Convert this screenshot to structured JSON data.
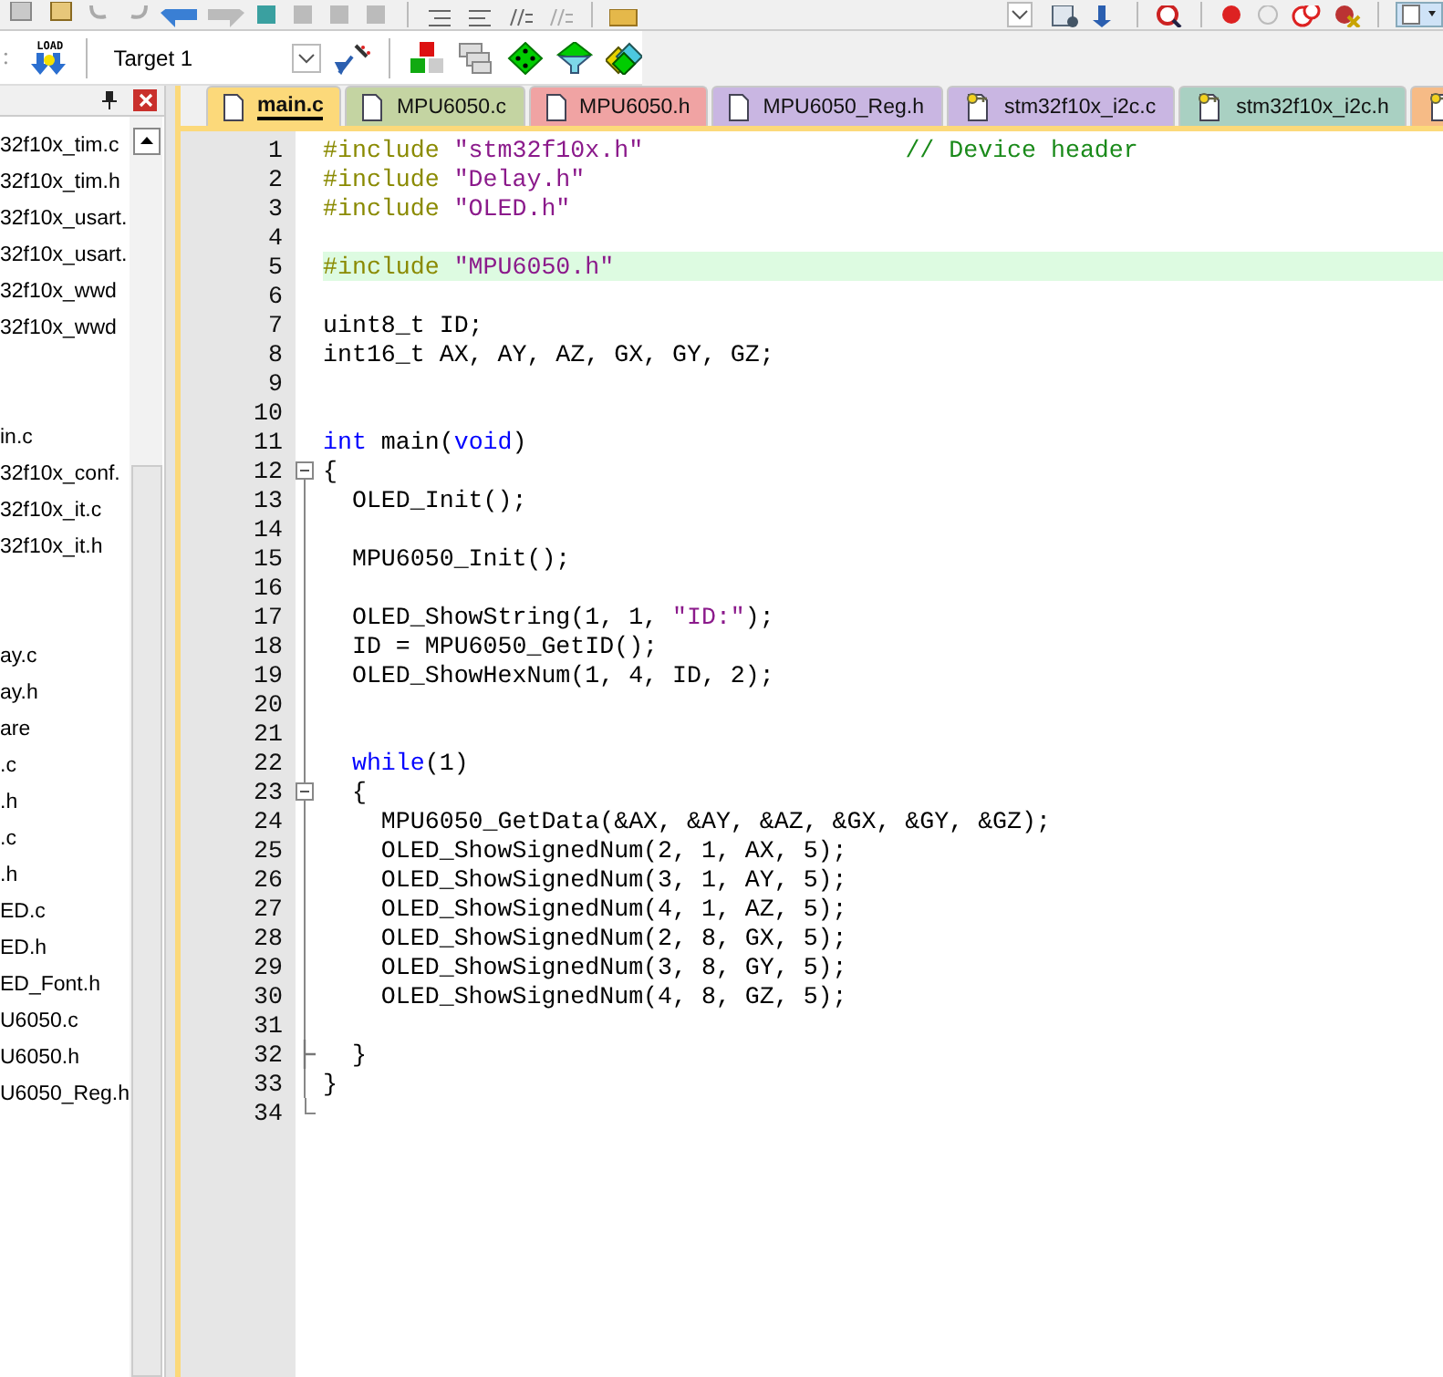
{
  "toolbar": {
    "load_label": "LOAD",
    "target": "Target 1"
  },
  "project_panel": {
    "groups": [
      {
        "items": [
          "32f10x_tim.c",
          "32f10x_tim.h",
          "32f10x_usart.",
          "32f10x_usart.",
          "32f10x_wwd",
          "32f10x_wwd"
        ]
      },
      {
        "items": [
          "in.c",
          "32f10x_conf.",
          "32f10x_it.c",
          "32f10x_it.h"
        ]
      },
      {
        "items": [
          "ay.c",
          "ay.h",
          "are",
          ".c",
          ".h",
          ".c",
          ".h",
          "ED.c",
          "ED.h",
          "ED_Font.h",
          "U6050.c",
          "U6050.h",
          "U6050_Reg.h"
        ]
      }
    ]
  },
  "tabs": [
    {
      "label": "main.c",
      "selected": true,
      "locked": false,
      "color": "#fcd97a"
    },
    {
      "label": "MPU6050.c",
      "selected": false,
      "locked": false,
      "color": "#c4d4a2"
    },
    {
      "label": "MPU6050.h",
      "selected": false,
      "locked": false,
      "color": "#f0a3a3"
    },
    {
      "label": "MPU6050_Reg.h",
      "selected": false,
      "locked": false,
      "color": "#c9b6e2"
    },
    {
      "label": "stm32f10x_i2c.c",
      "selected": false,
      "locked": true,
      "color": "#c9b6e2"
    },
    {
      "label": "stm32f10x_i2c.h",
      "selected": false,
      "locked": true,
      "color": "#a9d0c2"
    },
    {
      "selected": false,
      "locked": true,
      "color": "#f6bb86"
    }
  ],
  "code": [
    {
      "number": "1",
      "highlighted": false,
      "tokens": [
        {
          "kind": "pp",
          "text": "#include "
        },
        {
          "kind": "str",
          "text": "\"stm32f10x.h\"                  "
        },
        {
          "kind": "comment",
          "text": "// Device header"
        }
      ]
    },
    {
      "number": "2",
      "highlighted": false,
      "tokens": [
        {
          "kind": "pp",
          "text": "#include "
        },
        {
          "kind": "str",
          "text": "\"Delay.h\""
        }
      ]
    },
    {
      "number": "3",
      "highlighted": false,
      "tokens": [
        {
          "kind": "pp",
          "text": "#include "
        },
        {
          "kind": "str",
          "text": "\"OLED.h\""
        }
      ]
    },
    {
      "number": "4",
      "highlighted": false
    },
    {
      "number": "5",
      "highlighted": true,
      "tokens": [
        {
          "kind": "pp",
          "text": "#include "
        },
        {
          "kind": "str",
          "text": "\"MPU6050.h\""
        }
      ]
    },
    {
      "number": "6",
      "highlighted": false
    },
    {
      "number": "7",
      "highlighted": false,
      "tokens": [
        {
          "kind": "plain",
          "text": "uint8_t ID;"
        }
      ]
    },
    {
      "number": "8",
      "highlighted": false,
      "tokens": [
        {
          "kind": "plain",
          "text": "int16_t AX, AY, AZ, GX, GY, GZ;"
        }
      ]
    },
    {
      "number": "9",
      "highlighted": false
    },
    {
      "number": "10",
      "highlighted": false
    },
    {
      "number": "11",
      "highlighted": false,
      "tokens": [
        {
          "kind": "kw",
          "text": "int"
        },
        {
          "kind": "plain",
          "text": " main("
        },
        {
          "kind": "kw",
          "text": "void"
        },
        {
          "kind": "plain",
          "text": ")"
        }
      ]
    },
    {
      "number": "12",
      "highlighted": false,
      "collapsible": true,
      "tokens": [
        {
          "kind": "plain",
          "text": "{"
        }
      ]
    },
    {
      "number": "13",
      "highlighted": false,
      "tokens": [
        {
          "kind": "plain",
          "text": "  OLED_Init();"
        }
      ]
    },
    {
      "number": "14",
      "highlighted": false
    },
    {
      "number": "15",
      "highlighted": false,
      "tokens": [
        {
          "kind": "plain",
          "text": "  MPU6050_Init();"
        }
      ]
    },
    {
      "number": "16",
      "highlighted": false
    },
    {
      "number": "17",
      "highlighted": false,
      "tokens": [
        {
          "kind": "plain",
          "text": "  OLED_ShowString(1, 1, "
        },
        {
          "kind": "str",
          "text": "\"ID:\""
        },
        {
          "kind": "plain",
          "text": ");"
        }
      ]
    },
    {
      "number": "18",
      "highlighted": false,
      "tokens": [
        {
          "kind": "plain",
          "text": "  ID = MPU6050_GetID();"
        }
      ]
    },
    {
      "number": "19",
      "highlighted": false,
      "tokens": [
        {
          "kind": "plain",
          "text": "  OLED_ShowHexNum(1, 4, ID, 2);"
        }
      ]
    },
    {
      "number": "20",
      "highlighted": false
    },
    {
      "number": "21",
      "highlighted": false
    },
    {
      "number": "22",
      "highlighted": false,
      "tokens": [
        {
          "kind": "kw",
          "text": "  while"
        },
        {
          "kind": "plain",
          "text": "(1)"
        }
      ]
    },
    {
      "number": "23",
      "highlighted": false,
      "collapsible": true,
      "tokens": [
        {
          "kind": "plain",
          "text": "  {"
        }
      ]
    },
    {
      "number": "24",
      "highlighted": false,
      "tokens": [
        {
          "kind": "plain",
          "text": "    MPU6050_GetData(&AX, &AY, &AZ, &GX, &GY, &GZ);"
        }
      ]
    },
    {
      "number": "25",
      "highlighted": false,
      "tokens": [
        {
          "kind": "plain",
          "text": "    OLED_ShowSignedNum(2, 1, AX, 5);"
        }
      ]
    },
    {
      "number": "26",
      "highlighted": false,
      "tokens": [
        {
          "kind": "plain",
          "text": "    OLED_ShowSignedNum(3, 1, AY, 5);"
        }
      ]
    },
    {
      "number": "27",
      "highlighted": false,
      "tokens": [
        {
          "kind": "plain",
          "text": "    OLED_ShowSignedNum(4, 1, AZ, 5);"
        }
      ]
    },
    {
      "number": "28",
      "highlighted": false,
      "tokens": [
        {
          "kind": "plain",
          "text": "    OLED_ShowSignedNum(2, 8, GX, 5);"
        }
      ]
    },
    {
      "number": "29",
      "highlighted": false,
      "tokens": [
        {
          "kind": "plain",
          "text": "    OLED_ShowSignedNum(3, 8, GY, 5);"
        }
      ]
    },
    {
      "number": "30",
      "highlighted": false,
      "tokens": [
        {
          "kind": "plain",
          "text": "    OLED_ShowSignedNum(4, 8, GZ, 5);"
        }
      ]
    },
    {
      "number": "31",
      "highlighted": false
    },
    {
      "number": "32",
      "highlighted": false,
      "block_end": true,
      "tokens": [
        {
          "kind": "plain",
          "text": "  }"
        }
      ]
    },
    {
      "number": "33",
      "highlighted": false,
      "tokens": [
        {
          "kind": "plain",
          "text": "}"
        }
      ]
    },
    {
      "number": "34",
      "highlighted": false,
      "block_end": true
    }
  ]
}
